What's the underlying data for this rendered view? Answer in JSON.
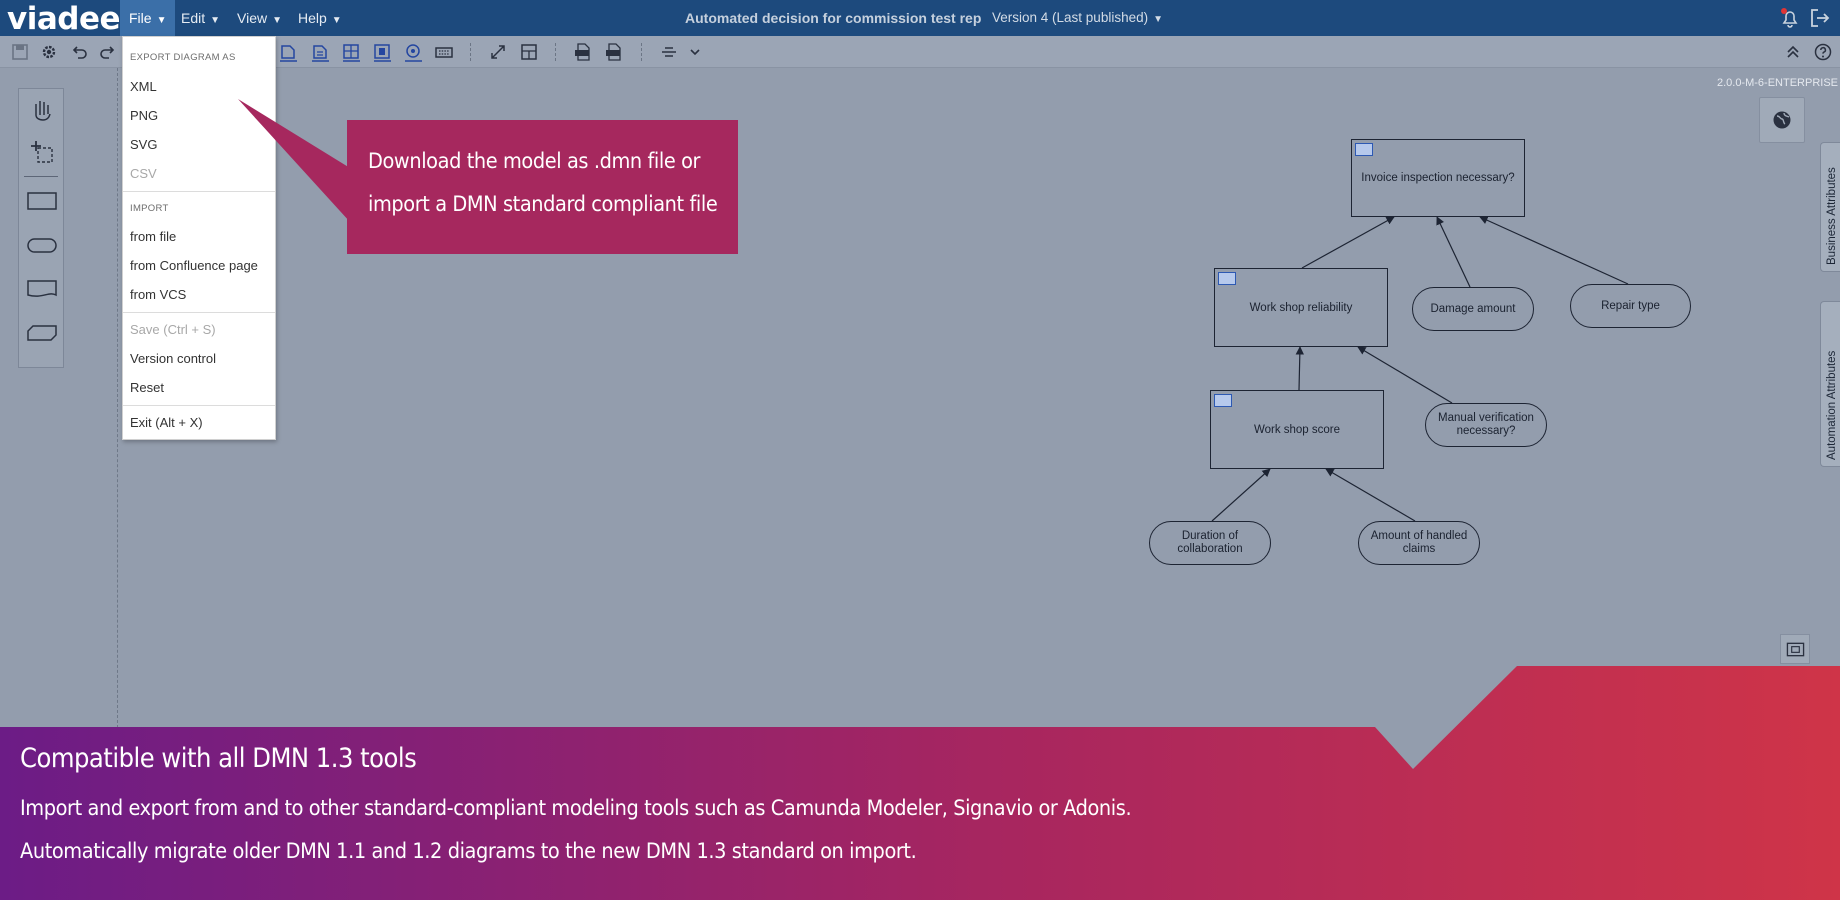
{
  "app": {
    "logo": "viadee"
  },
  "menubar": {
    "items": [
      {
        "label": "File"
      },
      {
        "label": "Edit"
      },
      {
        "label": "View"
      },
      {
        "label": "Help"
      }
    ],
    "document_title": "Automated decision for commission test rep",
    "version": "Version 4 (Last published)"
  },
  "toolbar": {
    "icons": [
      "save-icon",
      "settings-icon",
      "undo-icon",
      "redo-icon",
      "decision-table-icon",
      "bkm-icon",
      "decision-service-icon",
      "knowledge-source-icon",
      "text-annotation-icon",
      "literal-expression-icon",
      "keyboard-icon",
      "fullscreen-icon",
      "layout-icon",
      "export-xml-icon",
      "export-png-icon",
      "align-icon",
      "chevron-down-icon"
    ]
  },
  "file_menu": {
    "export_header": "EXPORT DIAGRAM AS",
    "export_items": [
      "XML",
      "PNG",
      "SVG",
      "CSV"
    ],
    "import_header": "IMPORT",
    "import_items": [
      "from file",
      "from Confluence page",
      "from VCS"
    ],
    "save": "Save (Ctrl + S)",
    "version_control": "Version control",
    "reset": "Reset",
    "exit": "Exit (Alt + X)"
  },
  "canvas": {
    "product_version": "2.0.0-M-6-ENTERPRISE",
    "side_tabs": [
      "Business Attributes",
      "Automation Attributes"
    ]
  },
  "diagram": {
    "decisions": [
      "Invoice inspection necessary?",
      "Work shop reliability",
      "Work shop score"
    ],
    "inputs": [
      "Damage amount",
      "Repair type",
      "Manual verification necessary?",
      "Duration of collaboration",
      "Amount of handled claims"
    ]
  },
  "callout": {
    "line1": "Download the model as .dmn file or",
    "line2": "import a DMN standard compliant file"
  },
  "banner": {
    "title": "Compatible with all DMN 1.3 tools",
    "line1": "Import and export from and to other standard-compliant modeling tools such as Camunda Modeler, Signavio or Adonis.",
    "line2": "Automatically migrate older DMN 1.1 and 1.2 diagrams to the new DMN 1.3 standard on import."
  },
  "colors": {
    "topbar": "#1d4a7d",
    "canvas": "#939dad",
    "callout": "#a6285e",
    "banner_start": "#6c1c86",
    "banner_end": "#cf3448"
  }
}
